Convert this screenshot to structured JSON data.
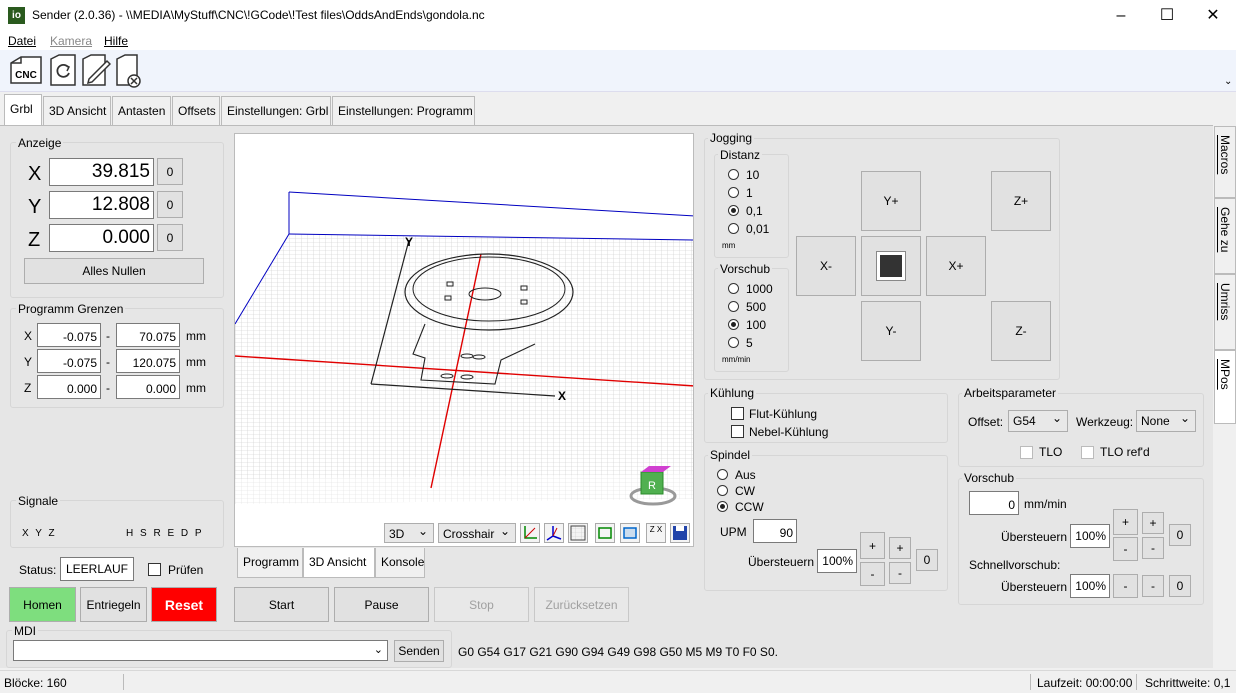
{
  "window": {
    "title": "Sender (2.0.36) - \\\\MEDIA\\MyStuff\\CNC\\!GCode\\!Test files\\OddsAndEnds\\gondola.nc",
    "icon_text": "io",
    "minimize": "–",
    "maximize": "☐",
    "close": "✕"
  },
  "menu": {
    "datei": "Datei",
    "kamera": "Kamera",
    "hilfe": "Hilfe"
  },
  "toolbar": {
    "cnc_label": "CNC"
  },
  "tabs": [
    "Grbl",
    "3D Ansicht",
    "Antasten",
    "Offsets",
    "Einstellungen: Grbl",
    "Einstellungen: Programm"
  ],
  "side_tabs": [
    "Macros",
    "Gehe zu",
    "Umriss",
    "MPos"
  ],
  "anzeige": {
    "label": "Anzeige",
    "axes": [
      {
        "name": "X",
        "value": "39.815",
        "zero": "0"
      },
      {
        "name": "Y",
        "value": "12.808",
        "zero": "0"
      },
      {
        "name": "Z",
        "value": "0.000",
        "zero": "0"
      }
    ],
    "zero_all": "Alles Nullen"
  },
  "grenzen": {
    "label": "Programm Grenzen",
    "rows": [
      {
        "axis": "X",
        "min": "-0.075",
        "max": "70.075",
        "unit": "mm"
      },
      {
        "axis": "Y",
        "min": "-0.075",
        "max": "120.075",
        "unit": "mm"
      },
      {
        "axis": "Z",
        "min": "0.000",
        "max": "0.000",
        "unit": "mm"
      }
    ],
    "dash": "-"
  },
  "signale": {
    "label": "Signale",
    "left": "X Y Z",
    "right": "H S R E D P"
  },
  "status": {
    "label": "Status:",
    "value": "LEERLAUF",
    "check_label": "Prüfen"
  },
  "machine_buttons": {
    "home": "Homen",
    "unlock": "Entriegeln",
    "reset": "Reset"
  },
  "viewer": {
    "view_mode": "3D",
    "cursor": "Crosshair",
    "axis_x": "X",
    "axis_y": "Y",
    "cube_label": "R",
    "zx_label": "Z X"
  },
  "bottom_tabs": [
    "Programm",
    "3D Ansicht",
    "Konsole"
  ],
  "program_buttons": {
    "start": "Start",
    "pause": "Pause",
    "stop": "Stop",
    "rewind": "Zurücksetzen"
  },
  "mdi": {
    "label": "MDI",
    "send": "Senden",
    "gcode_state": "G0 G54 G17 G21 G90 G94 G49 G98 G50 M5 M9 T0 F0 S0."
  },
  "jogging": {
    "label": "Jogging",
    "distanz_label": "Distanz",
    "distanz": [
      "10",
      "1",
      "0,1",
      "0,01"
    ],
    "distanz_selected": 2,
    "distanz_unit": "mm",
    "vorschub_label": "Vorschub",
    "vorschub": [
      "1000",
      "500",
      "100",
      "5"
    ],
    "vorschub_selected": 2,
    "vorschub_unit": "mm/min",
    "yplus": "Y+",
    "yminus": "Y-",
    "xplus": "X+",
    "xminus": "X-",
    "zplus": "Z+",
    "zminus": "Z-"
  },
  "kuehlung": {
    "label": "Kühlung",
    "flood": "Flut-Kühlung",
    "mist": "Nebel-Kühlung"
  },
  "spindel": {
    "label": "Spindel",
    "aus": "Aus",
    "cw": "CW",
    "ccw": "CCW",
    "rpm_label": "UPM",
    "rpm": "90",
    "override_label": "Übersteuern",
    "override": "100%",
    "plus": "+",
    "minus": "-",
    "zero": "0"
  },
  "arbeitsparameter": {
    "label": "Arbeitsparameter",
    "offset_label": "Offset:",
    "offset": "G54",
    "tool_label": "Werkzeug:",
    "tool": "None",
    "tlo": "TLO",
    "tlo_ref": "TLO ref'd"
  },
  "vorschub_panel": {
    "label": "Vorschub",
    "feed": "0",
    "feed_unit": "mm/min",
    "override_label": "Übersteuern",
    "override": "100%",
    "rapid_label": "Schnellvorschub:",
    "rapid_override_label": "Übersteuern",
    "rapid_override": "100%",
    "plus": "+",
    "minus": "-",
    "zero": "0"
  },
  "statusbar": {
    "blocks": "Blöcke: 160",
    "runtime": "Laufzeit: 00:00:00",
    "step": "Schrittweite: 0,1"
  },
  "colors": {
    "home_green": "#7ede7e",
    "reset_red": "#ff0000"
  }
}
